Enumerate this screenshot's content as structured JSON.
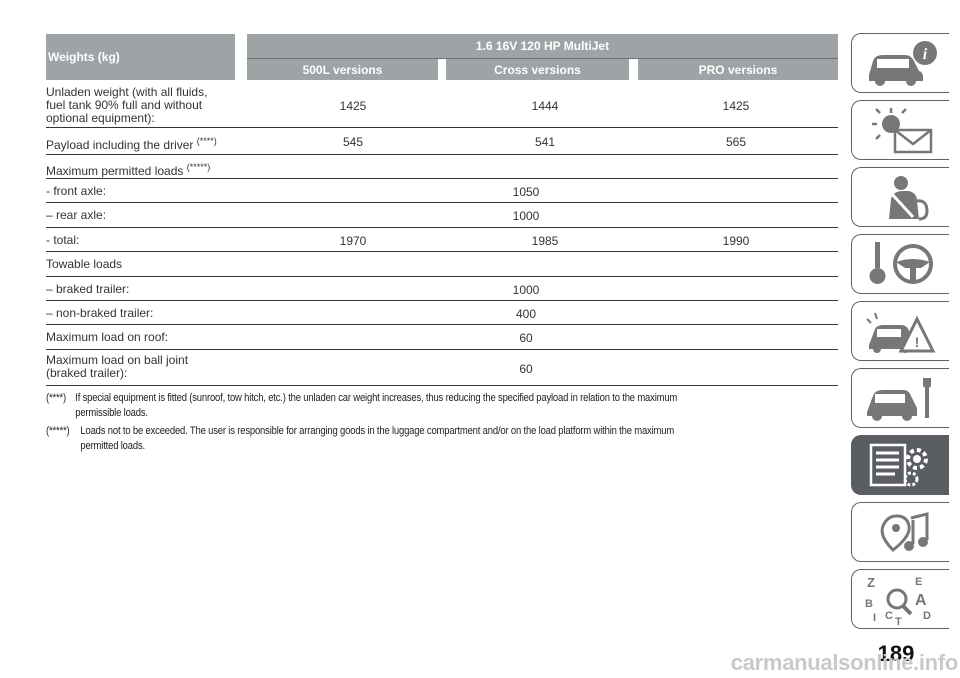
{
  "table": {
    "header": {
      "weights_label": "Weights (kg)",
      "engine": "1.6 16V 120 HP MultiJet",
      "versions": [
        "500L versions",
        "Cross versions",
        "PRO versions"
      ]
    },
    "rows": [
      {
        "label_lines": [
          "Unladen weight (with all fluids,",
          "fuel tank 90% full and without",
          "optional equipment):"
        ],
        "values": [
          "1425",
          "1444",
          "1425"
        ]
      },
      {
        "label": "Payload including the driver ",
        "note_mark": "(****)",
        "values": [
          "545",
          "541",
          "565"
        ]
      },
      {
        "label": "Maximum permitted loads ",
        "note_mark": "(*****)"
      },
      {
        "label": "- front axle:",
        "value": "1050"
      },
      {
        "label": "– rear axle:",
        "value": "1000"
      },
      {
        "label": "- total:",
        "values": [
          "1970",
          "1985",
          "1990"
        ]
      },
      {
        "label": "Towable loads"
      },
      {
        "label": "– braked trailer:",
        "value": "1000"
      },
      {
        "label": "– non-braked trailer:",
        "value": "400"
      },
      {
        "label": "Maximum load on roof:",
        "value": "60"
      },
      {
        "label_lines": [
          "Maximum load on ball joint",
          "(braked trailer):"
        ],
        "value": "60"
      }
    ]
  },
  "notes": [
    {
      "mark": "(****)",
      "text": "If special equipment is fitted (sunroof, tow hitch, etc.) the unladen car weight increases, thus reducing the specified payload in relation to the maximum permissible loads."
    },
    {
      "mark": "(*****)",
      "text": "Loads not to be exceeded. The user is responsible for arranging goods in the luggage compartment and/or on the load platform within the maximum permitted loads."
    }
  ],
  "page_number": "189",
  "watermark": "carmanualsonline.info",
  "sidebar_tabs": [
    "car-info-icon",
    "warning-lights-icon",
    "safety-icon",
    "starting-driving-icon",
    "emergency-icon",
    "maintenance-icon",
    "technical-data-icon",
    "multimedia-icon",
    "index-icon"
  ],
  "colors": {
    "header_bg": "#9ea3a6",
    "active_tab": "#5a5d62",
    "tab_border": "#5f6266"
  }
}
